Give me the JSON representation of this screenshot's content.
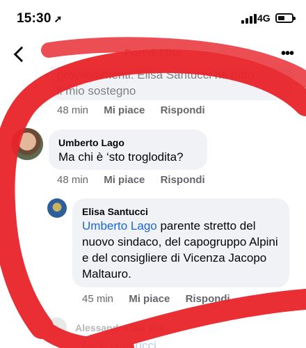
{
  "status": {
    "time": "15:30",
    "location_icon": "location-arrow-icon",
    "network": "4G"
  },
  "nav": {
    "title": "Post di Elisa"
  },
  "previous_comment": {
    "text_line1": "provvedimenti. Elisa Santucci ha tutto",
    "text_line2": "il mio sostegno",
    "time": "48 min",
    "like": "Mi piace",
    "reply": "Rispondi"
  },
  "comment_umberto": {
    "author": "Umberto Lago",
    "text": "Ma chi è ‘sto troglodita?",
    "time": "48 min",
    "like": "Mi piace",
    "reply": "Rispondi"
  },
  "reply_elisa": {
    "author": "Elisa Santucci",
    "mention": "Umberto Lago",
    "text": " parente stretto del nuovo sindaco, del capogruppo Alpini e del consigliere di Vicenza Jacopo Maltauro.",
    "time": "45 min",
    "like": "Mi piace",
    "reply": "Rispondi"
  },
  "next_comment": {
    "author": "Alessandra Dal Prà",
    "mention": "Elisa Santucci"
  }
}
